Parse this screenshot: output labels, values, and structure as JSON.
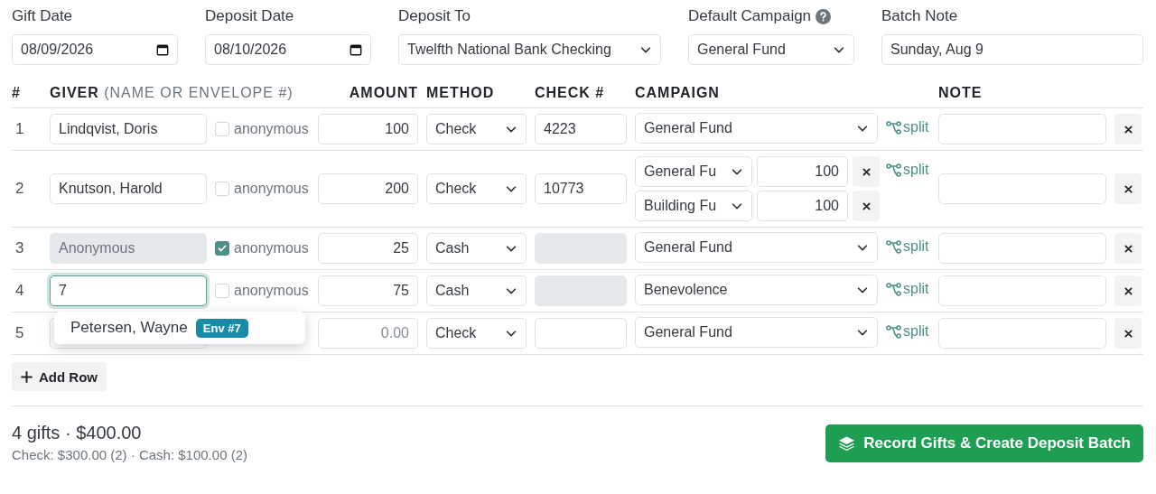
{
  "batch_fields": [
    {
      "kind": "date",
      "label": "Gift Date",
      "value": "08/09/2026"
    },
    {
      "kind": "date",
      "label": "Deposit Date",
      "value": "08/10/2026"
    },
    {
      "kind": "select",
      "label": "Deposit To",
      "value": "Twelfth National Bank Checking"
    },
    {
      "kind": "select",
      "label": "Default Campaign",
      "value": "General Fund",
      "help": true
    },
    {
      "kind": "text",
      "label": "Batch Note",
      "value": "Sunday, Aug 9"
    }
  ],
  "columns": [
    {
      "label": "#"
    },
    {
      "label": "GIVER",
      "hint": "(NAME OR ENVELOPE #)"
    },
    {
      "label": "AMOUNT"
    },
    {
      "label": "METHOD"
    },
    {
      "label": "CHECK #"
    },
    {
      "label": "CAMPAIGN"
    },
    {
      "label": "NOTE"
    }
  ],
  "rows": [
    {
      "number": "1",
      "giver": "Lindqvist, Doris",
      "giver_disabled": false,
      "focused": false,
      "anonymous": false,
      "anonymous_label": "anonymous",
      "amount": "100",
      "method": "Check",
      "check_number": "4223",
      "check_disabled": false,
      "campaigns": [
        {
          "fund": "General Fund"
        }
      ],
      "split_label": "split"
    },
    {
      "number": "2",
      "giver": "Knutson, Harold",
      "giver_disabled": false,
      "focused": false,
      "anonymous": false,
      "anonymous_label": "anonymous",
      "amount": "200",
      "method": "Check",
      "check_number": "10773",
      "check_disabled": false,
      "campaigns": [
        {
          "fund": "General Fu",
          "amount": "100"
        },
        {
          "fund": "Building Fu",
          "amount": "100"
        }
      ],
      "split_label": "split"
    },
    {
      "number": "3",
      "giver": "Anonymous",
      "giver_disabled": true,
      "focused": false,
      "anonymous": true,
      "anonymous_label": "anonymous",
      "amount": "25",
      "method": "Cash",
      "check_disabled": true,
      "campaigns": [
        {
          "fund": "General Fund"
        }
      ],
      "split_label": "split"
    },
    {
      "number": "4",
      "giver": "7",
      "giver_disabled": false,
      "focused": true,
      "anonymous": false,
      "anonymous_label": "anonymous",
      "amount": "75",
      "method": "Cash",
      "check_disabled": true,
      "campaigns": [
        {
          "fund": "Benevolence"
        }
      ],
      "split_label": "split",
      "suggestions": [
        {
          "name": "Petersen, Wayne",
          "badge": "Env #7"
        }
      ]
    },
    {
      "number": "5",
      "giver_disabled": false,
      "focused": false,
      "amount_placeholder": "0.00",
      "method": "Check",
      "check_disabled": false,
      "campaigns": [
        {
          "fund": "General Fund"
        }
      ],
      "split_label": "split"
    }
  ],
  "add_row": "Add Row",
  "summary": {
    "total": "4 gifts · $400.00",
    "breakdown": "Check: $300.00 (2) · Cash: $100.00 (2)"
  },
  "submit": "Record Gifts & Create Deposit Batch"
}
